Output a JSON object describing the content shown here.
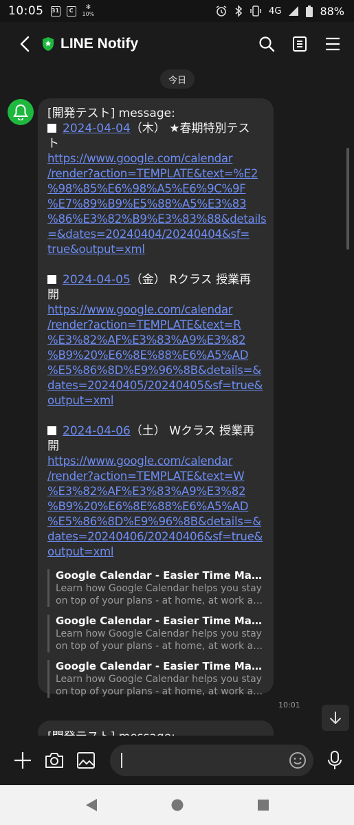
{
  "status_bar": {
    "time": "10:05",
    "calendar_badge": "31",
    "app_badge": "C",
    "data_badge": "10%",
    "network": "4G",
    "battery": "88%"
  },
  "header": {
    "title": "LINE Notify"
  },
  "date_divider": "今日",
  "message": {
    "header": "[開発テスト] message:",
    "events": [
      {
        "date": "2024-04-04",
        "rest_line1": "（木） ★春期特別テス",
        "rest_line2": "ト",
        "url_lines": [
          "https://www.google.com/calendar",
          "/render?action=TEMPLATE&text=%E2",
          "%98%85%E6%98%A5%E6%9C%9F",
          "%E7%89%B9%E5%88%A5%E3%83",
          "%86%E3%82%B9%E3%83%88&details",
          "=&dates=20240404/20240404&sf=",
          "true&output=xml"
        ]
      },
      {
        "date": "2024-04-05",
        "rest_line1": "（金） Rクラス 授業再",
        "rest_line2": "開",
        "url_lines": [
          "https://www.google.com/calendar",
          "/render?action=TEMPLATE&text=R",
          "%E3%82%AF%E3%83%A9%E3%82",
          "%B9%20%E6%8E%88%E6%A5%AD",
          "%E5%86%8D%E9%96%8B&details=&",
          "dates=20240405/20240405&sf=true&",
          "output=xml"
        ]
      },
      {
        "date": "2024-04-06",
        "rest_line1": "（土） Wクラス 授業再",
        "rest_line2": "開",
        "url_lines": [
          "https://www.google.com/calendar",
          "/render?action=TEMPLATE&text=W",
          "%E3%82%AF%E3%83%A9%E3%82",
          "%B9%20%E6%8E%88%E6%A5%AD",
          "%E5%86%8D%E9%96%8B&details=&",
          "dates=20240406/20240406&sf=true&",
          "output=xml"
        ]
      }
    ],
    "previews": [
      {
        "title": "Google Calendar - Easier Time Manage...",
        "desc_line1": "Learn how Google Calendar helps you stay",
        "desc_line2": "on top of your plans - at home, at work and ..."
      },
      {
        "title": "Google Calendar - Easier Time Manage...",
        "desc_line1": "Learn how Google Calendar helps you stay",
        "desc_line2": "on top of your plans - at home, at work and ..."
      },
      {
        "title": "Google Calendar - Easier Time Manage...",
        "desc_line1": "Learn how Google Calendar helps you stay",
        "desc_line2": "on top of your plans - at home, at work and ..."
      }
    ],
    "time": "10:01"
  },
  "next_message": {
    "header": "[開発テスト] message:"
  },
  "icons": {
    "back": "chevron-left-icon",
    "search": "search-icon",
    "notes": "notes-icon",
    "menu": "menu-icon",
    "plus": "plus-icon",
    "camera": "camera-icon",
    "image": "image-icon",
    "emoji": "emoji-icon",
    "mic": "mic-icon"
  },
  "colors": {
    "background": "#1b1b1b",
    "bubble": "#2d2d2d",
    "link": "#6d8cf2",
    "brand_green": "#1fb83f"
  }
}
